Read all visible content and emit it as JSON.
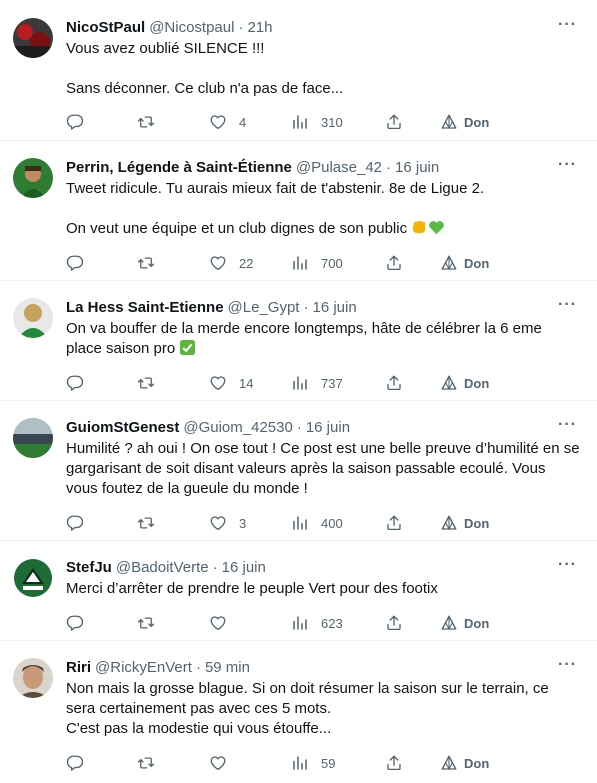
{
  "tweets": [
    {
      "name": "NicoStPaul",
      "handle": "@Nicostpaul",
      "time": "21h",
      "text": "Vous avez oublié SILENCE !!!\n\nSans déconner. Ce club n'a pas de face...",
      "replies": "",
      "retweets": "",
      "likes": "4",
      "views": "310",
      "don": "Don"
    },
    {
      "name": "Perrin, Légende à Saint-Étienne",
      "handle": "@Pulase_42",
      "time": "16 juin",
      "text": "Tweet ridicule. Tu aurais mieux fait de t'abstenir. 8e de Ligue 2.\n\nOn veut une équipe et un club dignes de son public",
      "replies": "",
      "retweets": "",
      "likes": "22",
      "views": "700",
      "don": "Don"
    },
    {
      "name": "La Hess Saint-Etienne",
      "handle": "@Le_Gypt",
      "time": "16 juin",
      "text": "On va bouffer de la merde encore longtemps, hâte de célébrer la 6 eme place saison pro",
      "replies": "",
      "retweets": "",
      "likes": "14",
      "views": "737",
      "don": "Don"
    },
    {
      "name": "GuiomStGenest",
      "handle": "@Guiom_42530",
      "time": "16 juin",
      "text": "Humilité ? ah oui ! On ose tout ! Ce post est une belle preuve d’humilité en se gargarisant de soit disant valeurs après la saison passable ecoulé. Vous vous foutez de la gueule du monde !",
      "replies": "",
      "retweets": "",
      "likes": "3",
      "views": "400",
      "don": "Don"
    },
    {
      "name": "StefJu",
      "handle": "@BadoitVerte",
      "time": "16 juin",
      "text": "Merci d’arrêter de prendre le peuple Vert pour des footix",
      "replies": "",
      "retweets": "",
      "likes": "",
      "views": "623",
      "don": "Don"
    },
    {
      "name": "Riri",
      "handle": "@RickyEnVert",
      "time": "59 min",
      "text": "Non mais la grosse blague. Si on doit résumer la saison sur le terrain, ce sera certainement pas avec ces 5 mots.\nC'est pas la modestie qui vous étouffe...",
      "replies": "",
      "retweets": "",
      "likes": "",
      "views": "59",
      "don": "Don"
    }
  ],
  "icons": {
    "reply": "reply-icon",
    "retweet": "retweet-icon",
    "like": "heart-icon",
    "views": "views-icon",
    "share": "share-icon",
    "don": "tip-icon",
    "more": "more-icon"
  },
  "colors": {
    "text": "#0f1419",
    "secondary": "#536471",
    "divider": "#eff3f4",
    "emoji_fist": "#f5b400",
    "emoji_heart": "#5bba47",
    "emoji_check": "#5fb43a"
  }
}
